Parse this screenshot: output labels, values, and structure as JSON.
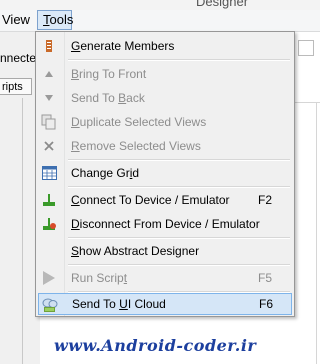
{
  "window": {
    "title": "Designer"
  },
  "menubar": {
    "view": "View",
    "tools": "Tools"
  },
  "background": {
    "left_label": "nnected",
    "left_tab": "ripts"
  },
  "menu": {
    "items": [
      {
        "id": "generate-members",
        "pre": "",
        "ul": "G",
        "post": "enerate Members",
        "shortcut": "",
        "disabled": false,
        "icon": "generate-members-icon"
      },
      {
        "id": "bring-to-front",
        "pre": "",
        "ul": "B",
        "post": "ring To Front",
        "shortcut": "",
        "disabled": true,
        "icon": "arrow-up-icon"
      },
      {
        "id": "send-to-back",
        "pre": "Send To ",
        "ul": "B",
        "post": "ack",
        "shortcut": "",
        "disabled": true,
        "icon": "arrow-down-icon"
      },
      {
        "id": "duplicate-selected-views",
        "pre": "",
        "ul": "D",
        "post": "uplicate Selected Views",
        "shortcut": "",
        "disabled": true,
        "icon": "duplicate-icon"
      },
      {
        "id": "remove-selected-views",
        "pre": "",
        "ul": "R",
        "post": "emove Selected Views",
        "shortcut": "",
        "disabled": true,
        "icon": "remove-icon"
      },
      {
        "id": "change-grid",
        "pre": "Change Gr",
        "ul": "i",
        "post": "d",
        "shortcut": "",
        "disabled": false,
        "icon": "grid-icon"
      },
      {
        "id": "connect-device",
        "pre": "",
        "ul": "C",
        "post": "onnect To Device / Emulator",
        "shortcut": "F2",
        "disabled": false,
        "icon": "connect-icon"
      },
      {
        "id": "disconnect-device",
        "pre": "",
        "ul": "D",
        "post": "isconnect From Device / Emulator",
        "shortcut": "",
        "disabled": false,
        "icon": "disconnect-icon"
      },
      {
        "id": "show-abstract-designer",
        "pre": "",
        "ul": "S",
        "post": "how Abstract Designer",
        "shortcut": "",
        "disabled": false,
        "icon": "abstract-designer-icon"
      },
      {
        "id": "run-script",
        "pre": "Run Scrip",
        "ul": "t",
        "post": "",
        "shortcut": "F5",
        "disabled": true,
        "icon": "play-icon"
      },
      {
        "id": "send-to-ui-cloud",
        "pre": "Send To ",
        "ul": "U",
        "post": "I Cloud",
        "shortcut": "F6",
        "disabled": false,
        "icon": "cloud-icon",
        "highlighted": true
      }
    ]
  },
  "watermark": "www.Android-coder.ir",
  "colors": {
    "highlight": "#d5e6f7",
    "highlight_border": "#7eb4ea",
    "watermark": "#1c3f9e"
  }
}
